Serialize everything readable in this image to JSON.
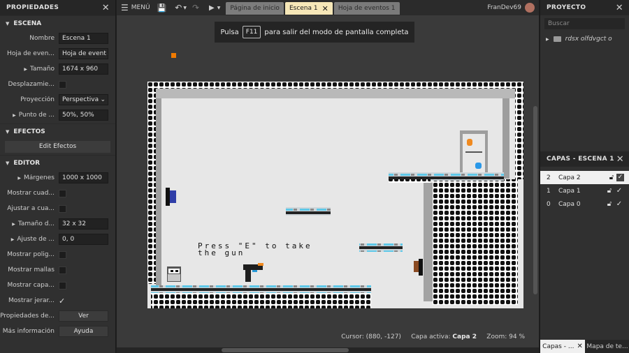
{
  "left_panel": {
    "title": "PROPIEDADES",
    "scene_section": "ESCENA",
    "scene_props": [
      {
        "label": "Nombre",
        "value": "Escena 1"
      },
      {
        "label": "Hoja de even...",
        "value": "Hoja de event"
      },
      {
        "label": "Tamaño",
        "value": "1674 x 960"
      },
      {
        "label": "Desplazamie...",
        "value": ""
      },
      {
        "label": "Proyección",
        "value": "Perspectiva"
      },
      {
        "label": "Punto de ...",
        "value": "50%, 50%"
      }
    ],
    "effects_section": "EFECTOS",
    "effects_button": "Edit Efectos",
    "editor_section": "EDITOR",
    "editor_props": [
      {
        "label": "Márgenes",
        "value": "1000 x 1000"
      },
      {
        "label": "Mostrar cuad...",
        "value": ""
      },
      {
        "label": "Ajustar a cua...",
        "value": ""
      },
      {
        "label": "Tamaño d...",
        "value": "32 x 32"
      },
      {
        "label": "Ajuste de ...",
        "value": "0, 0"
      },
      {
        "label": "Mostrar polig...",
        "value": ""
      },
      {
        "label": "Mostrar mallas",
        "value": ""
      },
      {
        "label": "Mostrar capa...",
        "value": ""
      },
      {
        "label": "Mostrar jerar...",
        "value": ""
      },
      {
        "label": "Propiedades de...",
        "value": "Ver"
      },
      {
        "label": "Más información",
        "value": "Ayuda"
      }
    ]
  },
  "toolbar": {
    "menu_label": "MENÚ",
    "tabs": [
      "Página de inicio",
      "Escena 1",
      "Hoja de eventos 1"
    ],
    "user": "FranDev69"
  },
  "canvas": {
    "hint_before": "Pulsa",
    "hint_key": "F11",
    "hint_after": "para salir del modo de pantalla completa",
    "scene_text_line1": "Press \"E\" to take",
    "scene_text_line2": "the gun",
    "status_cursor": "Cursor: (880, -127)",
    "status_layer_label": "Capa activa:",
    "status_layer_value": "Capa 2",
    "status_zoom": "Zoom: 94 %"
  },
  "project_panel": {
    "title": "PROYECTO",
    "search_placeholder": "Buscar",
    "item": "rdsx olfdvgct o"
  },
  "layers_panel": {
    "title": "CAPAS - ESCENA 1",
    "layers": [
      {
        "num": "2",
        "name": "Capa 2"
      },
      {
        "num": "1",
        "name": "Capa 1"
      },
      {
        "num": "0",
        "name": "Capa 0"
      }
    ],
    "bottom_tabs": [
      "Capas - ...",
      "Mapa de te..."
    ]
  },
  "colors": {
    "active_tab": "#f6e7b8",
    "panel_bg": "#303030",
    "canvas_bg": "#3a3a3a"
  }
}
